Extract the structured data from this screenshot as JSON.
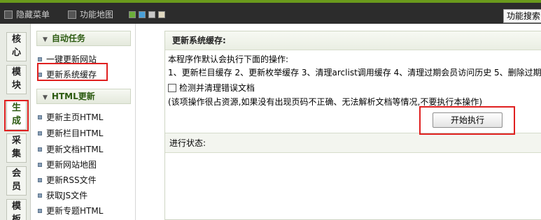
{
  "topbar": {
    "hide_menu": "隐藏菜单",
    "feature_map": "功能地图",
    "search_button": "功能搜索",
    "swatch_colors": [
      "#6cae3a",
      "#4aa0d8",
      "#c8c8c8",
      "#e0d8c0"
    ]
  },
  "left_tabs": [
    {
      "line1": "核",
      "line2": "心"
    },
    {
      "line1": "模",
      "line2": "块"
    },
    {
      "line1": "生",
      "line2": "成"
    },
    {
      "line1": "采",
      "line2": "集"
    },
    {
      "line1": "会",
      "line2": "员"
    },
    {
      "line1": "模",
      "line2": "板"
    }
  ],
  "menu": {
    "auto_task_header": "自动任务",
    "auto_items": [
      "一键更新网站",
      "更新系统缓存"
    ],
    "html_header": "HTML更新",
    "html_items": [
      "更新主页HTML",
      "更新栏目HTML",
      "更新文档HTML",
      "更新网站地图",
      "更新RSS文件",
      "获取JS文件",
      "更新专题HTML"
    ]
  },
  "panel": {
    "title": "更新系统缓存:",
    "intro": "本程序作默认会执行下面的操作:",
    "operations": "1、更新栏目缓存 2、更新枚举缓存 3、清理arclist调用缓存 4、清理过期会员访问历史 5、删除过期",
    "checkbox_label": "检测并清理错误文档",
    "note": "(该项操作很占资源,如果没有出现页码不正确、无法解析文档等情况,不要执行本操作)",
    "run_button": "开始执行",
    "status_label": "进行状态:"
  },
  "highlight_color": "#e02020"
}
